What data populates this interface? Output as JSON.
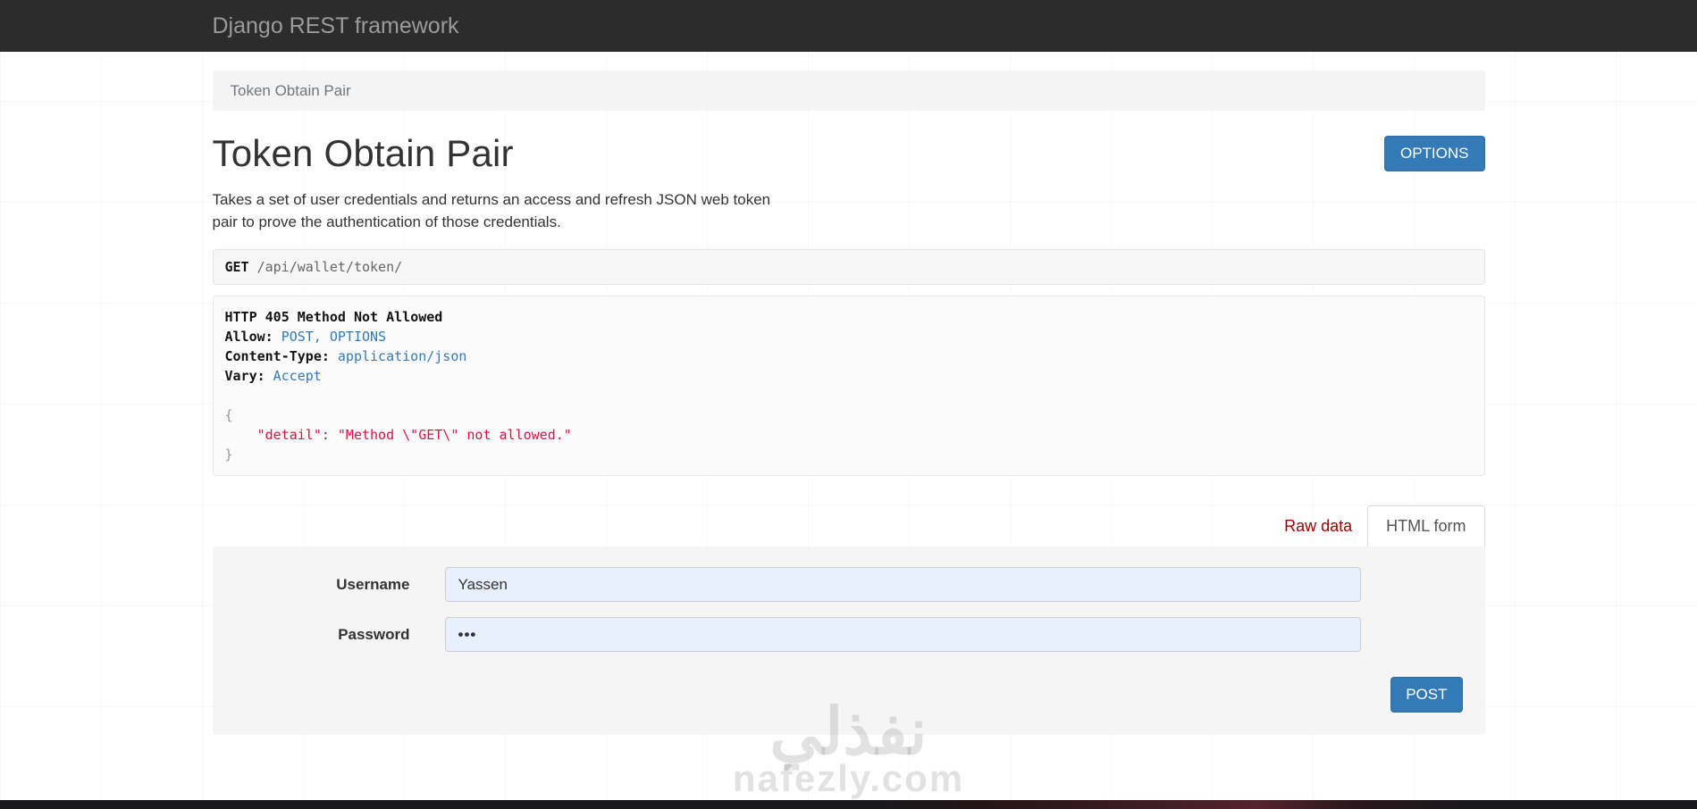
{
  "navbar": {
    "brand": "Django REST framework"
  },
  "breadcrumb": {
    "current": "Token Obtain Pair"
  },
  "header": {
    "title": "Token Obtain Pair",
    "options_button": "OPTIONS",
    "description": "Takes a set of user credentials and returns an access and refresh JSON web token pair to prove the authentication of those credentials."
  },
  "request": {
    "method": "GET",
    "path": "/api/wallet/token/"
  },
  "response": {
    "status_line": "HTTP 405 Method Not Allowed",
    "headers": [
      {
        "name": "Allow:",
        "value": "POST, OPTIONS"
      },
      {
        "name": "Content-Type:",
        "value": "application/json"
      },
      {
        "name": "Vary:",
        "value": "Accept"
      }
    ],
    "body": {
      "open": "{",
      "key": "    \"detail\"",
      "colon": ":",
      "value": "\"Method \\\"GET\\\" not allowed.\"",
      "close": "}"
    }
  },
  "tabs": [
    {
      "label": "Raw data",
      "active": false
    },
    {
      "label": "HTML form",
      "active": true
    }
  ],
  "form": {
    "fields": [
      {
        "label": "Username",
        "value": "Yassen"
      },
      {
        "label": "Password",
        "value": "•••"
      }
    ],
    "submit_label": "POST"
  },
  "watermark": {
    "arabic": "نفذلي",
    "latin": "nafezly.com"
  },
  "colors": {
    "navbar_bg": "#2c2c2c",
    "accent_blue": "#337ab7",
    "raw_data_red": "#a30000",
    "json_string_red": "#dd1144",
    "header_value_blue": "#337ab7",
    "panel_bg": "#f5f5f5",
    "input_bg": "#e8f0fe"
  }
}
